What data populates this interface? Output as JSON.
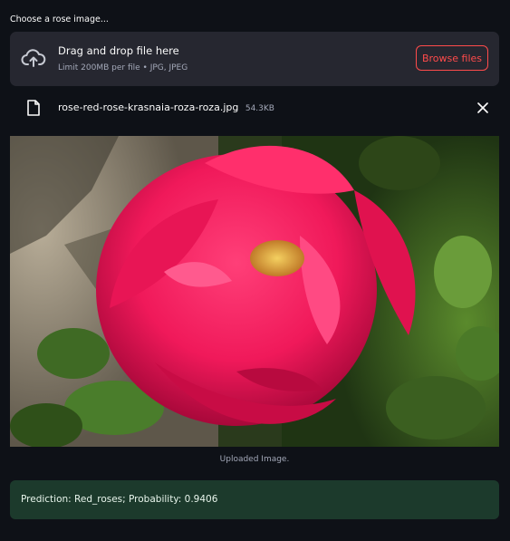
{
  "uploader": {
    "label": "Choose a rose image...",
    "drop_title": "Drag and drop file here",
    "limit_text": "Limit 200MB per file • JPG, JPEG",
    "browse_label": "Browse files",
    "cloud_icon": "cloud-upload-icon"
  },
  "file": {
    "name": "rose-red-rose-krasnaia-roza-roza.jpg",
    "size": "54.3KB",
    "file_icon": "file-icon",
    "remove_icon": "close-icon"
  },
  "image": {
    "caption": "Uploaded Image."
  },
  "result": {
    "text": "Prediction: Red_roses; Probability: 0.9406"
  },
  "colors": {
    "background": "#0e1117",
    "panel": "#262730",
    "accent": "#ff4b4b",
    "success_bg": "#1c3a2c"
  }
}
